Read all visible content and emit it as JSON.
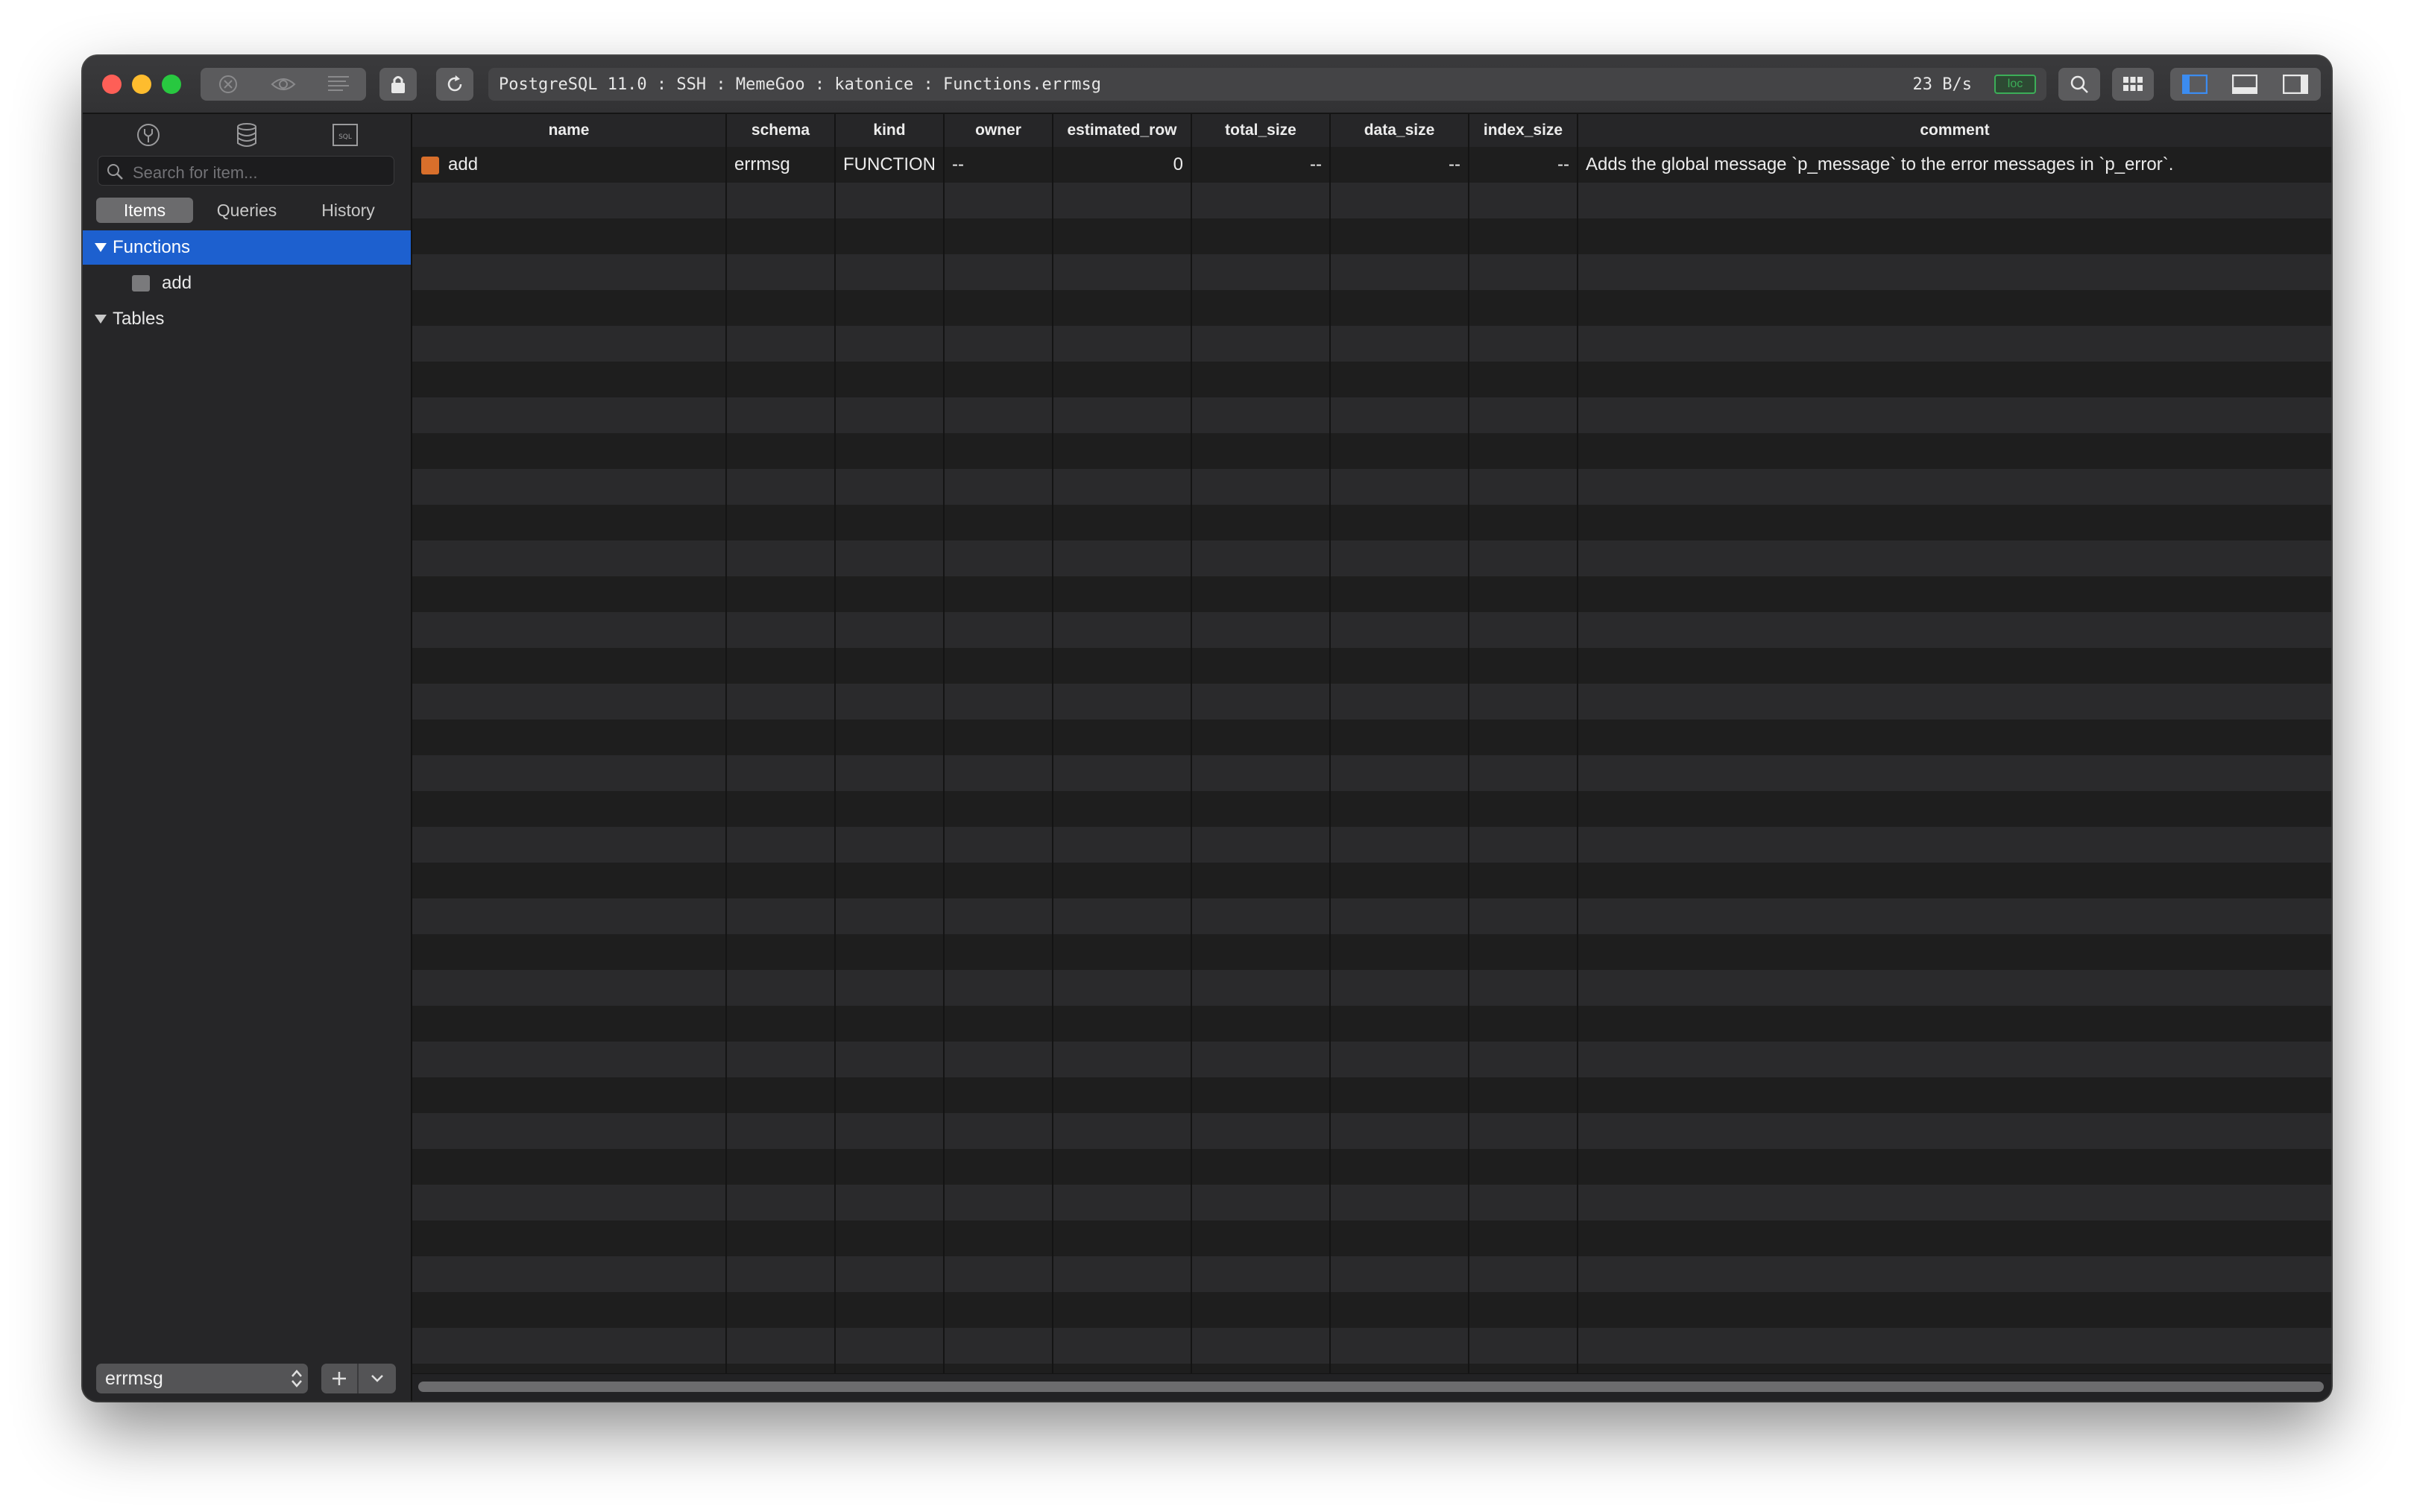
{
  "window": {
    "connection_title": "PostgreSQL 11.0 : SSH : MemeGoo : katonice : Functions.errmsg",
    "network_speed": "23 B/s",
    "network_badge": "loc"
  },
  "icons": {
    "stop": "stop-icon",
    "preview": "eye-icon",
    "console": "console-icon",
    "lock": "lock-icon",
    "reload": "reload-icon",
    "search": "search-icon",
    "grid": "grid-icon",
    "panel_left": "panel-left-icon",
    "panel_bottom": "panel-bottom-icon",
    "panel_right": "panel-right-icon"
  },
  "sidebar": {
    "search_placeholder": "Search for item...",
    "tabs": [
      "Items",
      "Queries",
      "History"
    ],
    "active_tab": "Items",
    "tree": {
      "functions_label": "Functions",
      "functions_items": [
        "add"
      ],
      "tables_label": "Tables"
    },
    "database": "errmsg"
  },
  "table": {
    "columns": [
      "name",
      "schema",
      "kind",
      "owner",
      "estimated_row",
      "total_size",
      "data_size",
      "index_size",
      "comment"
    ],
    "rows": [
      {
        "name": "add",
        "schema": "errmsg",
        "kind": "FUNCTION",
        "owner": "--",
        "estimated_row": "0",
        "total_size": "--",
        "data_size": "--",
        "index_size": "--",
        "comment": "Adds the global message `p_message` to the error messages in `p_error`."
      }
    ]
  },
  "colors": {
    "accent": "#1d60cf",
    "function_icon": "#d86f2b",
    "badge_green": "#3cae58"
  }
}
